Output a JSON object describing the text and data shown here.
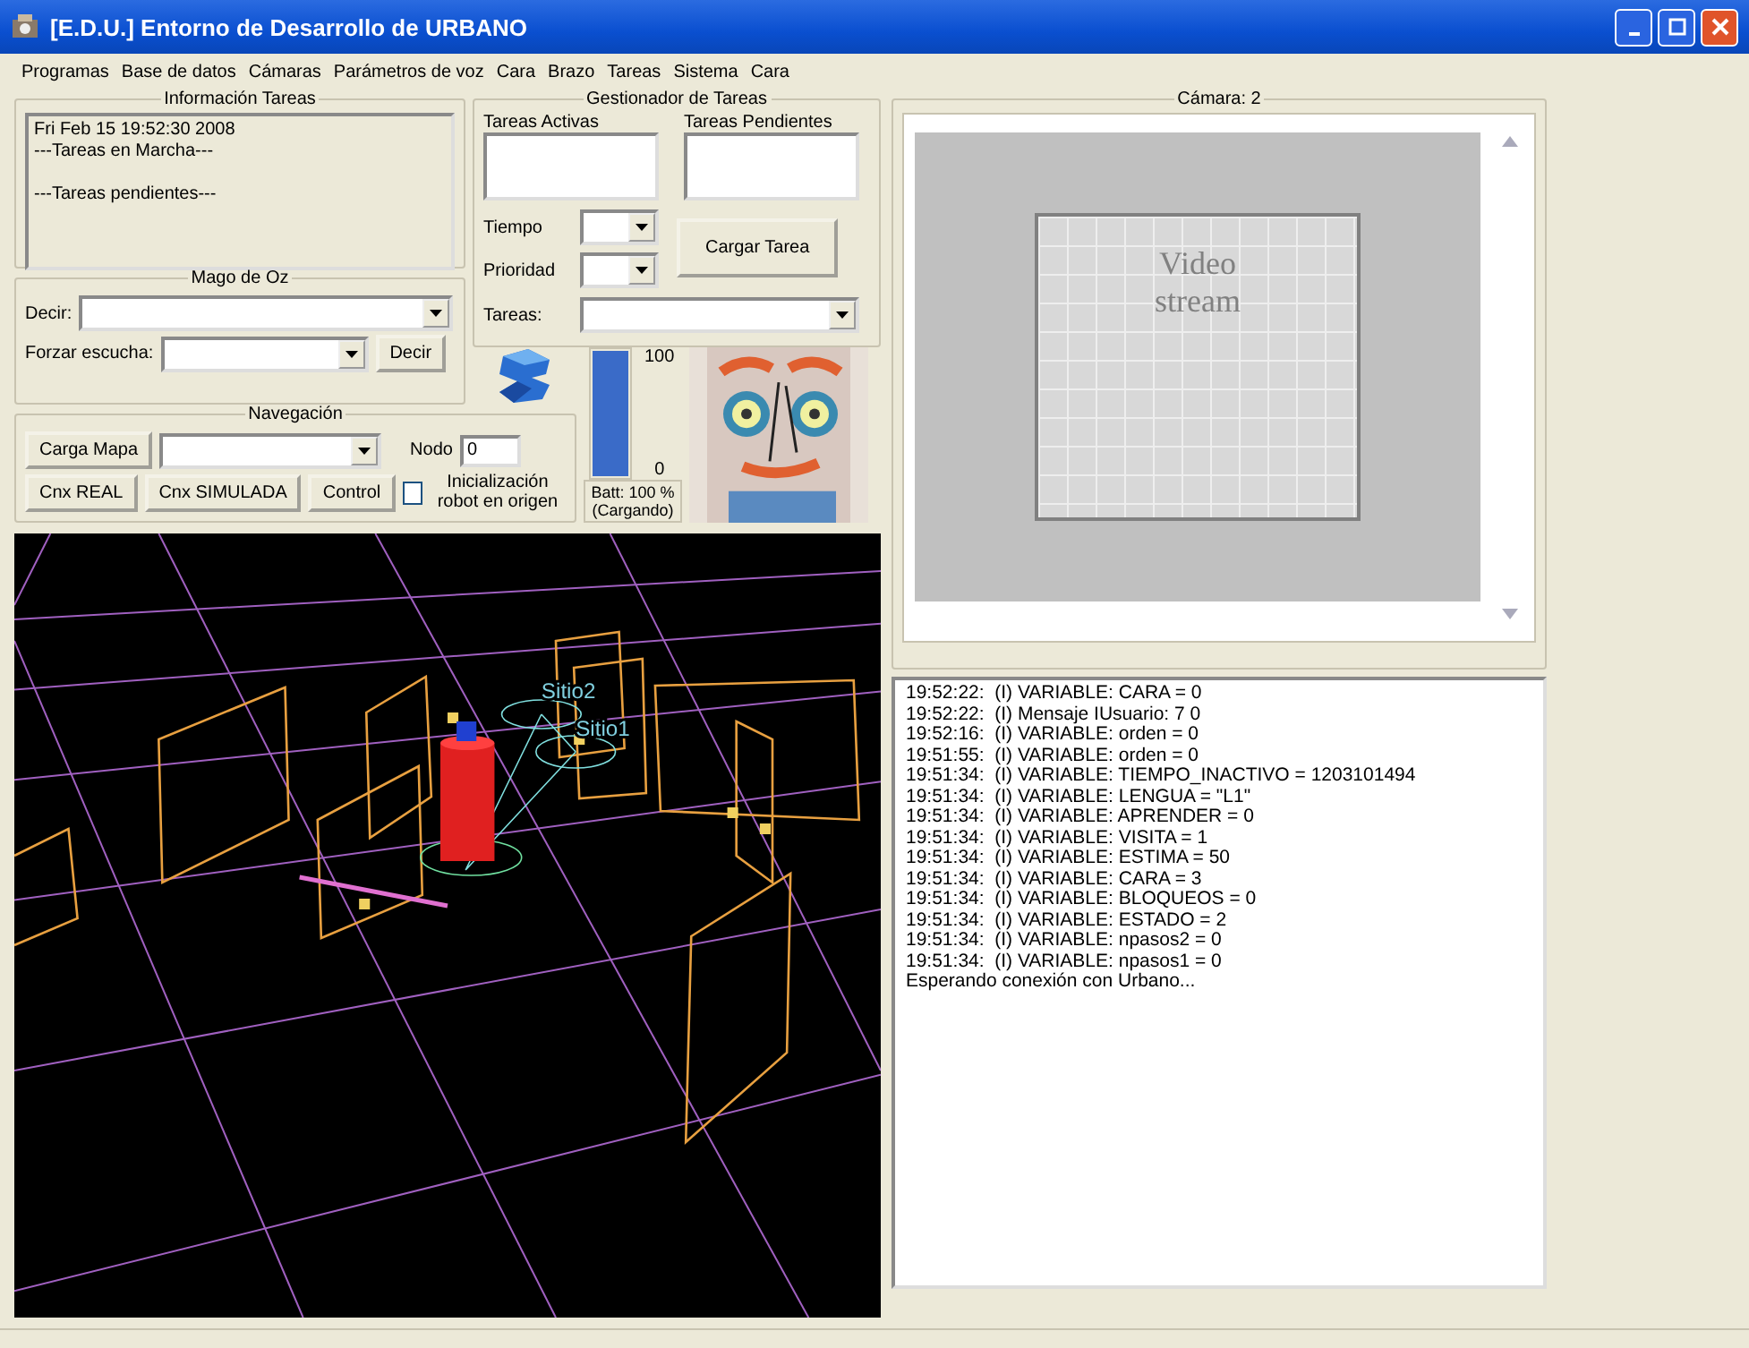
{
  "window": {
    "title": "[E.D.U.] Entorno de Desarrollo de URBANO"
  },
  "menu": [
    "Programas",
    "Base de datos",
    "Cámaras",
    "Parámetros de voz",
    "Cara",
    "Brazo",
    "Tareas",
    "Sistema",
    "Cara"
  ],
  "info_tareas": {
    "title": "Información Tareas",
    "lines": [
      "Fri Feb 15 19:52:30 2008",
      "---Tareas en Marcha---",
      "---Tareas pendientes---"
    ]
  },
  "gestionador": {
    "title": "Gestionador de Tareas",
    "activas_label": "Tareas Activas",
    "pendientes_label": "Tareas Pendientes",
    "tiempo_label": "Tiempo",
    "prioridad_label": "Prioridad",
    "cargar_button": "Cargar Tarea",
    "tareas_label": "Tareas:"
  },
  "mago": {
    "title": "Mago de Oz",
    "decir_label": "Decir:",
    "forzar_label": "Forzar escucha:",
    "decir_button": "Decir"
  },
  "navegacion": {
    "title": "Navegación",
    "carga_button": "Carga Mapa",
    "nodo_label": "Nodo",
    "nodo_value": "0",
    "real_button": "Cnx REAL",
    "simulada_button": "Cnx SIMULADA",
    "control_button": "Control",
    "init_checkbox": {
      "label": "Inicialización robot en origen",
      "checked": false
    }
  },
  "battery": {
    "level": 1.0,
    "max_label": "100",
    "min_label": "0",
    "status": "Batt: 100 %",
    "charging": "(Cargando)"
  },
  "scene": {
    "labels": [
      "Sitio2",
      "Sitio1"
    ]
  },
  "camera": {
    "title": "Cámara: 2",
    "placeholder_lines": [
      "Video",
      "stream"
    ]
  },
  "log": {
    "lines": [
      "19:52:22:  (I) VARIABLE: CARA = 0",
      "19:52:22:  (I) Mensaje IUsuario: 7 0",
      "19:52:16:  (I) VARIABLE: orden = 0",
      "19:51:55:  (I) VARIABLE: orden = 0",
      "19:51:34:  (I) VARIABLE: TIEMPO_INACTIVO = 1203101494",
      "19:51:34:  (I) VARIABLE: LENGUA = \"L1\"",
      "19:51:34:  (I) VARIABLE: APRENDER = 0",
      "19:51:34:  (I) VARIABLE: VISITA = 1",
      "19:51:34:  (I) VARIABLE: ESTIMA = 50",
      "19:51:34:  (I) VARIABLE: CARA = 3",
      "19:51:34:  (I) VARIABLE: BLOQUEOS = 0",
      "19:51:34:  (I) VARIABLE: ESTADO = 2",
      "19:51:34:  (I) VARIABLE: npasos2 = 0",
      "19:51:34:  (I) VARIABLE: npasos1 = 0",
      "Esperando conexión con Urbano..."
    ]
  }
}
